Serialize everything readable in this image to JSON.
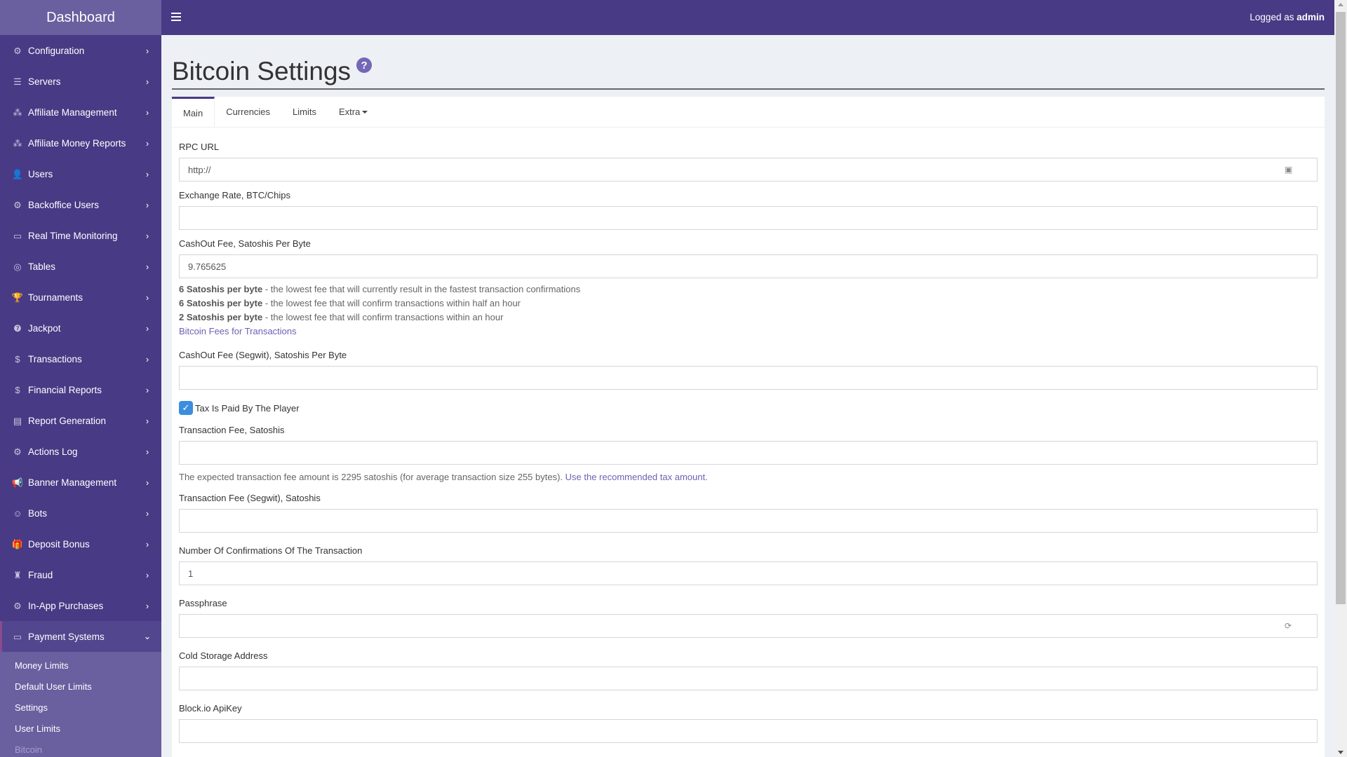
{
  "sidebar": {
    "brand": "Dashboard",
    "items": [
      {
        "label": "Configuration",
        "icon": "⚙"
      },
      {
        "label": "Servers",
        "icon": "☰"
      },
      {
        "label": "Affiliate Management",
        "icon": "⁂"
      },
      {
        "label": "Affiliate Money Reports",
        "icon": "⁂"
      },
      {
        "label": "Users",
        "icon": "👤"
      },
      {
        "label": "Backoffice Users",
        "icon": "⚙"
      },
      {
        "label": "Real Time Monitoring",
        "icon": "▭"
      },
      {
        "label": "Tables",
        "icon": "◎"
      },
      {
        "label": "Tournaments",
        "icon": "🏆"
      },
      {
        "label": "Jackpot",
        "icon": "❼"
      },
      {
        "label": "Transactions",
        "icon": "$"
      },
      {
        "label": "Financial Reports",
        "icon": "$"
      },
      {
        "label": "Report Generation",
        "icon": "▤"
      },
      {
        "label": "Actions Log",
        "icon": "⚙"
      },
      {
        "label": "Banner Management",
        "icon": "📢"
      },
      {
        "label": "Bots",
        "icon": "☺"
      },
      {
        "label": "Deposit Bonus",
        "icon": "🎁"
      },
      {
        "label": "Fraud",
        "icon": "♜"
      },
      {
        "label": "In-App Purchases",
        "icon": "⚙"
      }
    ],
    "open_item": {
      "label": "Payment Systems",
      "icon": "▭"
    },
    "submenu": [
      "Money Limits",
      "Default User Limits",
      "Settings",
      "User Limits",
      "Bitcoin"
    ]
  },
  "header": {
    "logged_prefix": "Logged as",
    "user": "admin"
  },
  "page": {
    "title": "Bitcoin Settings",
    "help": "?"
  },
  "tabs": [
    "Main",
    "Currencies",
    "Limits",
    "Extra"
  ],
  "form": {
    "rpc_url": {
      "label": "RPC URL",
      "value": "http://"
    },
    "exchange_rate": {
      "label": "Exchange Rate, BTC/Chips",
      "value": ""
    },
    "cashout_fee": {
      "label": "CashOut Fee, Satoshis Per Byte",
      "value": "9.765625"
    },
    "fee_hints": [
      {
        "bold": "6 Satoshis per byte",
        "text": " - the lowest fee that will currently result in the fastest transaction confirmations"
      },
      {
        "bold": "6 Satoshis per byte",
        "text": " - the lowest fee that will confirm transactions within half an hour"
      },
      {
        "bold": "2 Satoshis per byte",
        "text": " - the lowest fee that will confirm transactions within an hour"
      }
    ],
    "fees_link": "Bitcoin Fees for Transactions",
    "cashout_fee_segwit": {
      "label": "CashOut Fee (Segwit), Satoshis Per Byte",
      "value": ""
    },
    "tax_checkbox": {
      "label": "Tax Is Paid By The Player",
      "checked": true
    },
    "transaction_fee": {
      "label": "Transaction Fee, Satoshis",
      "value": ""
    },
    "expected_fee_text": "The expected transaction fee amount is 2295 satoshis (for average transaction size 255 bytes). ",
    "recommended_link": "Use the recommended tax amount.",
    "transaction_fee_segwit": {
      "label": "Transaction Fee (Segwit), Satoshis",
      "value": ""
    },
    "confirmations": {
      "label": "Number Of Confirmations Of The Transaction",
      "value": "1"
    },
    "passphrase": {
      "label": "Passphrase",
      "value": ""
    },
    "cold_storage": {
      "label": "Cold Storage Address",
      "value": ""
    },
    "blockio_key": {
      "label": "Block.io ApiKey",
      "value": ""
    }
  }
}
